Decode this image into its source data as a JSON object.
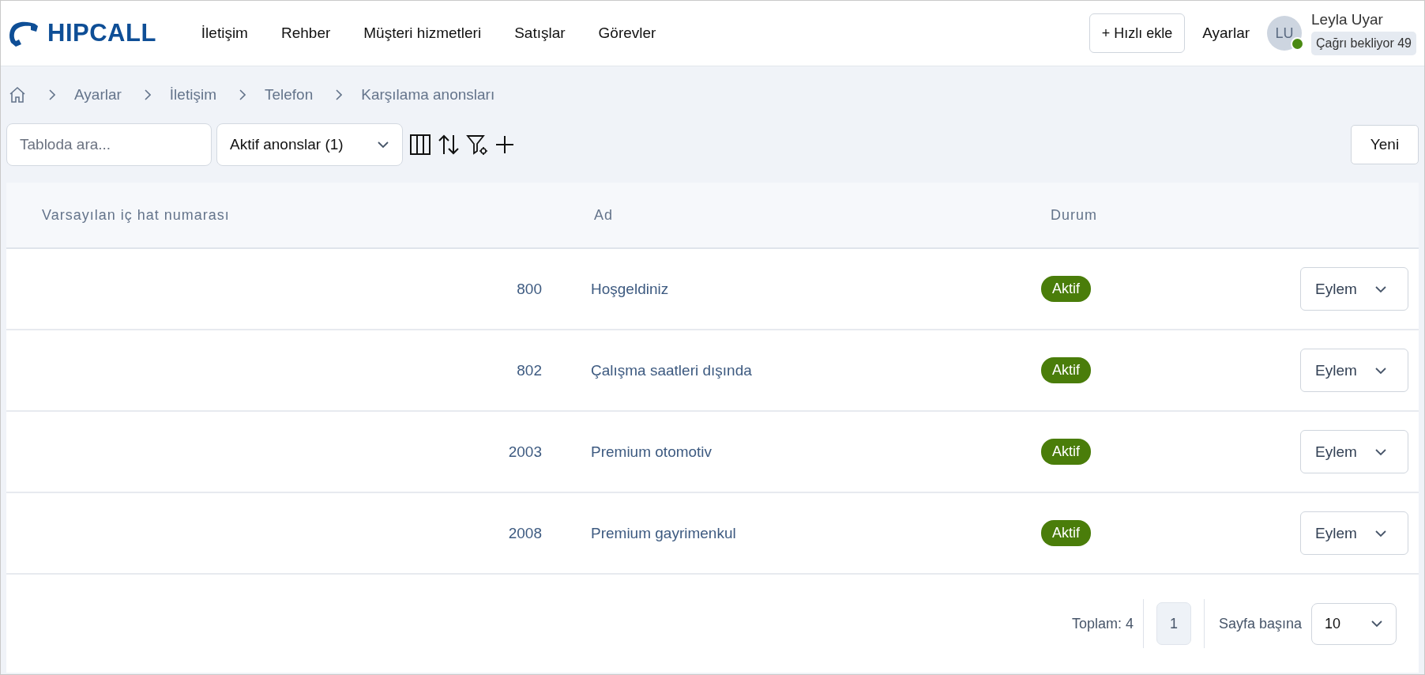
{
  "logo": {
    "text": "HIPCALL"
  },
  "nav": [
    {
      "label": "İletişim"
    },
    {
      "label": "Rehber"
    },
    {
      "label": "Müşteri hizmetleri"
    },
    {
      "label": "Satışlar"
    },
    {
      "label": "Görevler"
    }
  ],
  "quick_add": "+ Hızlı ekle",
  "settings_link": "Ayarlar",
  "user": {
    "initials": "LU",
    "name": "Leyla Uyar",
    "online": true,
    "status": "Çağrı bekliyor 49"
  },
  "breadcrumb": [
    "Ayarlar",
    "İletişim",
    "Telefon",
    "Karşılama anonsları"
  ],
  "toolbar": {
    "search_placeholder": "Tabloda ara...",
    "filter": "Aktif anonslar (1)",
    "new_button": "Yeni"
  },
  "table": {
    "columns": [
      "Varsayılan iç hat numarası",
      "Ad",
      "Durum"
    ],
    "rows": [
      {
        "extension": "800",
        "name": "Hoşgeldiniz",
        "status": "Aktif",
        "action": "Eylem"
      },
      {
        "extension": "802",
        "name": "Çalışma saatleri dışında",
        "status": "Aktif",
        "action": "Eylem"
      },
      {
        "extension": "2003",
        "name": "Premium otomotiv",
        "status": "Aktif",
        "action": "Eylem"
      },
      {
        "extension": "2008",
        "name": "Premium gayrimenkul",
        "status": "Aktif",
        "action": "Eylem"
      }
    ]
  },
  "pagination": {
    "total": "Toplam: 4",
    "pages": [
      {
        "label": "1",
        "selected": true
      }
    ],
    "per_page_label": "Sayfa başına",
    "per_page": "10"
  }
}
